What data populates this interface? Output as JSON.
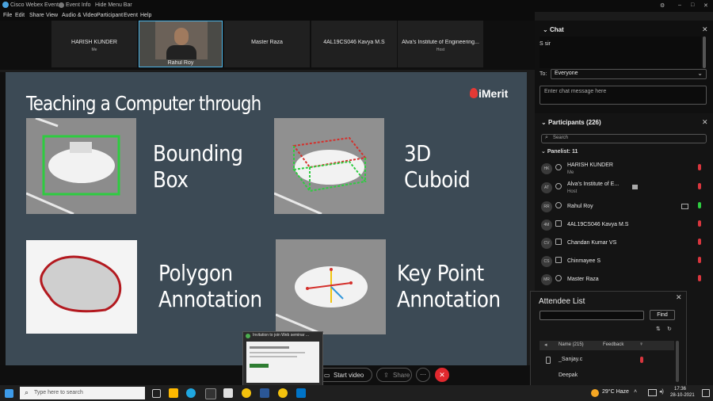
{
  "titlebar": {
    "app": "Cisco Webex Events",
    "event_info": "Event Info",
    "hide_menu": "Hide Menu Bar"
  },
  "menu": [
    "File",
    "Edit",
    "Share",
    "View",
    "Audio & Video",
    "Participant",
    "Event",
    "Help"
  ],
  "video_tiles": [
    {
      "name": "HARISH KUNDER",
      "sub": "Me"
    },
    {
      "name": "Rahul Roy",
      "sub": ""
    },
    {
      "name": "Master Raza",
      "sub": ""
    },
    {
      "name": "4AL19CS046 Kavya M.S",
      "sub": ""
    },
    {
      "name": "Alva's Institute of Engineering...",
      "sub": "Host"
    }
  ],
  "slide": {
    "title": "Teaching a Computer through",
    "brand": "iMerit",
    "labels": [
      {
        "l1": "Bounding",
        "l2": "Box"
      },
      {
        "l1": "3D",
        "l2": "Cuboid"
      },
      {
        "l1": "Polygon",
        "l2": "Annotation"
      },
      {
        "l1": "Key Point",
        "l2": "Annotation"
      }
    ]
  },
  "controls": {
    "start_video": "Start video",
    "share": "Share",
    "more": "···"
  },
  "thumbnail": {
    "title": "Invitation to join Web seminar ..."
  },
  "chat": {
    "title": "Chat",
    "message": "S sir",
    "to_label": "To:",
    "to_value": "Everyone",
    "placeholder": "Enter chat message here"
  },
  "participants": {
    "title": "Participants (226)",
    "search_placeholder": "Search",
    "group": "Panelist: 11",
    "rows": [
      {
        "initials": "HK",
        "name": "HARISH KUNDER",
        "role": "Me"
      },
      {
        "initials": "AT",
        "name": "Alva's Institute of E...",
        "role": "Host"
      },
      {
        "initials": "RR",
        "name": "Rahul Roy",
        "role": ""
      },
      {
        "initials": "4M",
        "name": "4AL19CS046 Kavya M.S",
        "role": ""
      },
      {
        "initials": "CV",
        "name": "Chandan Kumar VS",
        "role": ""
      },
      {
        "initials": "CS",
        "name": "Chinmayee S",
        "role": ""
      },
      {
        "initials": "MR",
        "name": "Master Raza",
        "role": ""
      }
    ]
  },
  "attendee": {
    "title": "Attendee List",
    "find": "Find",
    "col_name": "Name (215)",
    "col_feedback": "Feedback",
    "rows": [
      "_Sanjay.c",
      "Deepak"
    ]
  },
  "taskbar": {
    "search": "Type here to search",
    "weather": "29°C  Haze",
    "time": "17:36",
    "date": "28-10-2021"
  }
}
